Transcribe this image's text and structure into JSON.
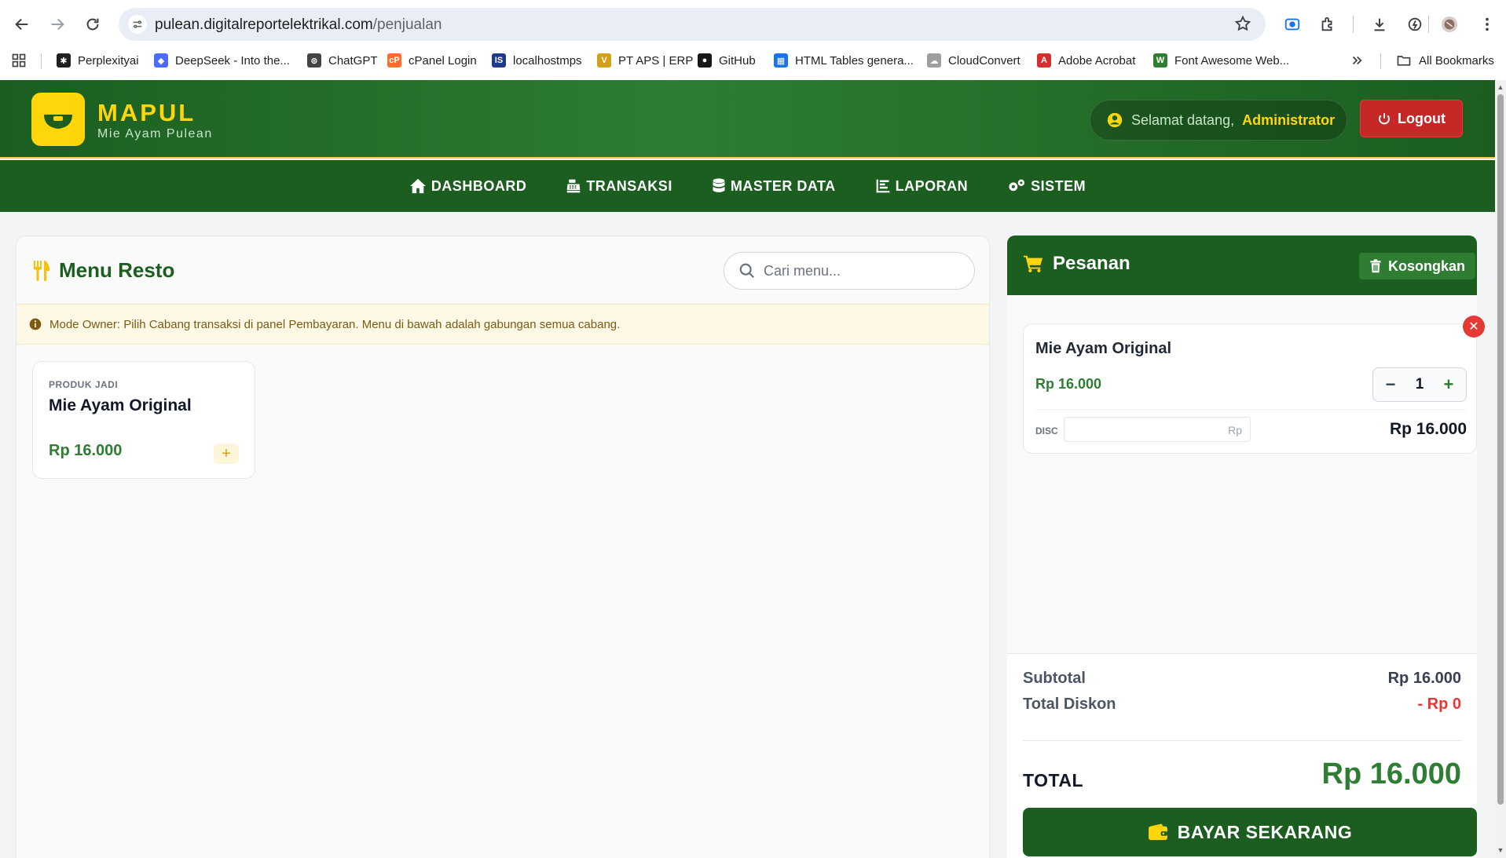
{
  "browser": {
    "url_host": "pulean.digitalreportelektrikal.com",
    "url_path": "/penjualan",
    "bookmarks": [
      {
        "label": "Perplexityai",
        "color": "#1f1f1f",
        "glyph": "✱"
      },
      {
        "label": "DeepSeek - Into the...",
        "color": "#4d6bfe",
        "glyph": "◆"
      },
      {
        "label": "ChatGPT",
        "color": "#444444",
        "glyph": "⊛"
      },
      {
        "label": "cPanel Login",
        "color": "#ff6c2c",
        "glyph": "cP"
      },
      {
        "label": "localhostmps",
        "color": "#1e3a8a",
        "glyph": "IS"
      },
      {
        "label": "PT APS | ERP",
        "color": "#d4a017",
        "glyph": "V"
      },
      {
        "label": "GitHub",
        "color": "#181717",
        "glyph": "●"
      },
      {
        "label": "HTML Tables genera...",
        "color": "#1a73e8",
        "glyph": "▦"
      },
      {
        "label": "CloudConvert",
        "color": "#9e9e9e",
        "glyph": "☁"
      },
      {
        "label": "Adobe Acrobat",
        "color": "#d32f2f",
        "glyph": "A"
      },
      {
        "label": "Font Awesome Web...",
        "color": "#2e7d32",
        "glyph": "W"
      }
    ],
    "all_bookmarks": "All Bookmarks"
  },
  "header": {
    "brand": "MAPUL",
    "brand_sub": "Mie Ayam Pulean",
    "welcome_text": "Selamat datang,",
    "user_name": "Administrator",
    "logout_label": "Logout"
  },
  "nav": [
    {
      "label": "DASHBOARD",
      "icon": "home-icon"
    },
    {
      "label": "TRANSAKSI",
      "icon": "cash-register-icon"
    },
    {
      "label": "MASTER DATA",
      "icon": "database-icon"
    },
    {
      "label": "LAPORAN",
      "icon": "chart-icon"
    },
    {
      "label": "SISTEM",
      "icon": "cogs-icon"
    }
  ],
  "menu_panel": {
    "title": "Menu Resto",
    "search_placeholder": "Cari menu...",
    "notice": "Mode Owner: Pilih Cabang transaksi di panel Pembayaran. Menu di bawah adalah gabungan semua cabang.",
    "products": [
      {
        "category": "PRODUK JADI",
        "name": "Mie Ayam Original",
        "price": "Rp 16.000",
        "add_label": "+"
      }
    ]
  },
  "order_panel": {
    "title": "Pesanan",
    "clear_label": "Kosongkan",
    "items": [
      {
        "name": "Mie Ayam Original",
        "price": "Rp 16.000",
        "qty": "1",
        "disc_label": "DISC",
        "disc_currency": "Rp",
        "line_total": "Rp 16.000"
      }
    ],
    "subtotal_label": "Subtotal",
    "subtotal_value": "Rp 16.000",
    "discount_label": "Total Diskon",
    "discount_value": "- Rp 0",
    "total_label": "TOTAL",
    "total_value": "Rp 16.000",
    "pay_label": "BAYAR SEKARANG"
  },
  "colors": {
    "primary_green": "#1b5e20",
    "accent_yellow": "#ffd60a",
    "danger_red": "#c62828",
    "price_green": "#2e7d32"
  }
}
